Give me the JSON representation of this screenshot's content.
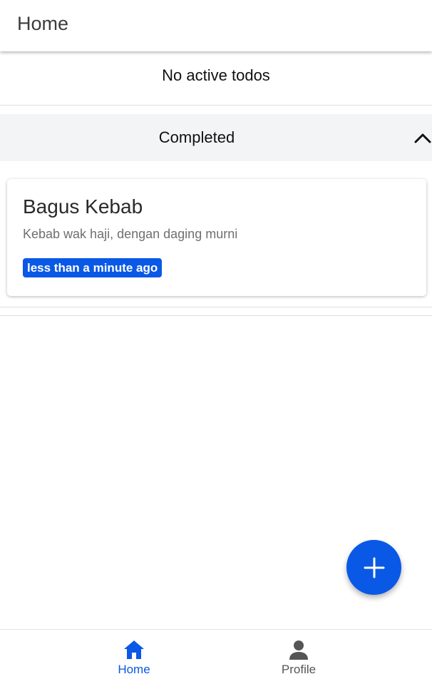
{
  "app_bar": {
    "title": "Home"
  },
  "active_section": {
    "empty_text": "No active todos"
  },
  "completed_section": {
    "label": "Completed",
    "toggle_icon": "chevron-up-icon"
  },
  "todos_completed": [
    {
      "title": "Bagus Kebab",
      "description": "Kebab wak haji, dengan daging murni",
      "time": "less than a minute ago"
    }
  ],
  "fab": {
    "icon": "plus-icon"
  },
  "bottom_nav": {
    "items": [
      {
        "label": "Home",
        "icon": "home-icon",
        "active": true
      },
      {
        "label": "Profile",
        "icon": "person-icon",
        "active": false
      }
    ]
  },
  "colors": {
    "accent": "#0a58e6",
    "section_bg": "#f3f4f6",
    "inactive_nav": "#555555"
  }
}
